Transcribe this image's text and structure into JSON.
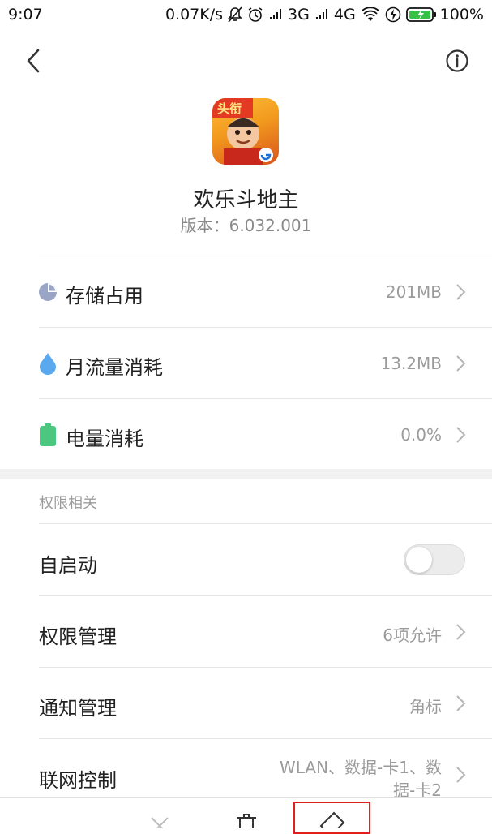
{
  "status_bar": {
    "time": "9:07",
    "net_speed": "0.07K/s",
    "sig1_label": "3G",
    "sig2_label": "4G",
    "battery_text": "100%",
    "icons": [
      "mute-icon",
      "alarm-icon",
      "signal-icon",
      "signal-icon",
      "wifi-icon",
      "flash-icon",
      "battery-icon"
    ]
  },
  "app": {
    "name": "欢乐斗地主",
    "version": "版本：6.032.001",
    "icon_badge": "头衔"
  },
  "usage": [
    {
      "label": "存储占用",
      "value": "201MB",
      "icon": "storage-pie-icon",
      "color": "#9aa4c4"
    },
    {
      "label": "月流量消耗",
      "value": "13.2MB",
      "icon": "data-drop-icon",
      "color": "#5aa8ee"
    },
    {
      "label": "电量消耗",
      "value": "0.0%",
      "icon": "battery-icon",
      "color": "#4cc77f"
    }
  ],
  "permissions": {
    "section_title": "权限相关",
    "autostart_label": "自启动",
    "autostart_enabled": false,
    "items": [
      {
        "label": "权限管理",
        "value": "6项允许"
      },
      {
        "label": "通知管理",
        "value": "角标"
      },
      {
        "label": "联网控制",
        "value_line1": "WLAN、数据-卡1、数",
        "value_line2": "据-卡2"
      }
    ]
  },
  "bottom_actions": [
    "close-icon",
    "delete-icon",
    "clear-data-icon"
  ],
  "colors": {
    "highlight": "#e0201c",
    "section_bg": "#f2f2f2"
  }
}
